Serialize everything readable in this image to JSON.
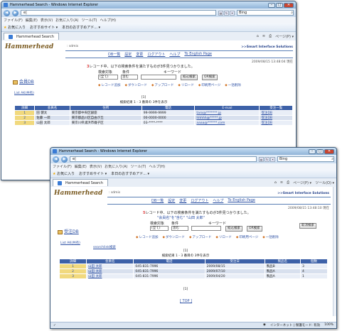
{
  "w1": {
    "title": "Hammerhead Search - Windows Internet Explorer",
    "address": "e|",
    "search": "Bing",
    "menu": [
      "ファイル(F)",
      "編集(E)",
      "表示(V)",
      "お気に入り(A)",
      "ツール(T)",
      "ヘルプ(H)"
    ],
    "menu_extra": "× ✎",
    "fav": [
      "お気に入り",
      "おすすめサイト ▾",
      "本日のおすすめアド... ▾"
    ],
    "tab": "Hammerhead Search",
    "tab_tools": [
      "ページ(P) ▾"
    ],
    "logo": "Hammerhead",
    "user": ": sdmis",
    "company": ">>Smart Interface Solutions",
    "nav": [
      "DB一覧",
      "設定",
      "変更",
      "ログアウト",
      "ヘルプ",
      "To English Page"
    ],
    "date": "2009/08/15 13:48:04 現在",
    "msg_pre": "",
    "msg_red": "3",
    "msg_post": "レコード中、以下の検索条件を満たすものが3件見つかりました。",
    "side": "会員DB",
    "form": {
      "label1": "検索対象",
      "label2": "条件",
      "label3": "キーワード",
      "sel1": "(全て)",
      "sel2": "含む",
      "btn1": "絞込検索",
      "btn2": "OR検索"
    },
    "actions": [
      "レコード追加",
      "ダウンロード",
      "アップロード",
      "リロード",
      "印刷用ページ",
      "一括削除"
    ],
    "listlink": "List AK(共有)",
    "pager1": "[1]",
    "pager2": "検索結果 1 - 3 番目の 3件を表示",
    "headers": [
      "詳細",
      "会員名",
      "住所",
      "電話",
      "E-mail",
      "受注一覧"
    ],
    "rows": [
      [
        "1",
        "田 健太",
        "東京都中央区銀座",
        "99-9999-9999",
        "taro@*******.jp",
        "受注DB"
      ],
      [
        "2",
        "佐藤 一郎",
        "東京都品川区自由が丘",
        "00-0000-0000",
        "hhhhh@*****.jp",
        "受注DB"
      ],
      [
        "3",
        "山田 太郎",
        "東京川県浦浜市磯子区",
        "03-****-****",
        "aaaa@******.com",
        "受注DB"
      ]
    ]
  },
  "w2": {
    "title": "Hammerhead Search - Windows Internet Explorer",
    "address": "e|",
    "search": "Bing",
    "menu": [
      "ファイル(F)",
      "編集(E)",
      "表示(V)",
      "お気に入り(A)",
      "ツール(T)",
      "ヘルプ(H)"
    ],
    "fav": [
      "お気に入り",
      "おすすめサイト ▾",
      "本日のおすすめアド... ▾"
    ],
    "tab": "Hammerhead Search",
    "tab_tools": [
      "ページ(P) ▾",
      "ツール(O) ▾"
    ],
    "logo": "Hammerhead",
    "user": ": sdmis",
    "company": ">>Smart Interface Solutions",
    "nav": [
      "DB一覧",
      "設定",
      "変更",
      "ログアウト",
      "ヘルプ",
      "To English Page"
    ],
    "date": "2009/08/15 13:48:10 現在",
    "msg_red": "5",
    "msg_post": "レコード中、以下の検索条件を満たすものが3件見つかりました。",
    "msg2": "\"会員名\"を\"含む\" \"山田 太郎\"",
    "side": "受注DB",
    "form": {
      "label1": "検索対象",
      "label2": "条件",
      "label3": "キーワード",
      "sel1": "(全て)",
      "sel2": "含む",
      "btn1": "絞込検索",
      "btn2": "OR検索",
      "btn3": "取消検索"
    },
    "actions": [
      "レコード追加",
      "ダウンロード",
      "アップロード",
      "リロード",
      "印刷用ページ",
      "一括削除"
    ],
    "listlink": "List AK(共有)",
    "searchlink": "searchlink検索",
    "pager1": "[1]",
    "pager2": "検索結果 1 - 3 番目の 3件を表示",
    "headers": [
      "詳細",
      "会員名",
      "電話",
      "受注日",
      "製品名",
      "個数"
    ],
    "rows": [
      [
        "1",
        "山田 太郎",
        "045-831-7996",
        "2009/08/15",
        "製品B",
        "3"
      ],
      [
        "2",
        "山田 太郎",
        "045-831-7996",
        "2009/07/10",
        "製品A",
        "4"
      ],
      [
        "3",
        "山田 太郎",
        "045-831-7996",
        "2009/04/20",
        "製品A",
        "1"
      ]
    ],
    "pager3": "[1]",
    "top": "[ TOP ]",
    "status_left": "✓",
    "status_zone": "インターネット | 保護モード: 有効",
    "zoom": "100%"
  }
}
